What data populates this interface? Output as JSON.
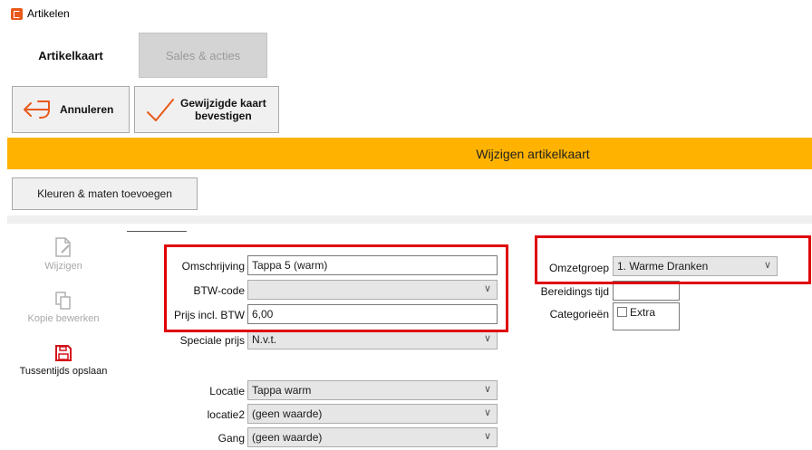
{
  "window": {
    "title": "Artikelen"
  },
  "tabs": [
    {
      "label": "Artikelkaart",
      "active": true
    },
    {
      "label": "Sales & acties",
      "active": false
    }
  ],
  "actions": {
    "cancel_label": "Annuleren",
    "confirm_label_line1": "Gewijzigde kaart",
    "confirm_label_line2": "bevestigen"
  },
  "banner": {
    "text": "Wijzigen artikelkaart",
    "color": "#ffb300"
  },
  "kleuren_button": {
    "label": "Kleuren & maten toevoegen"
  },
  "side_actions": [
    {
      "label": "Wijzigen",
      "icon": "document-edit-icon",
      "enabled": false
    },
    {
      "label": "Kopie bewerken",
      "icon": "copy-icon",
      "enabled": false
    },
    {
      "label": "Tussentijds opslaan",
      "icon": "save-icon",
      "enabled": true
    }
  ],
  "form": {
    "omschrijving": {
      "label": "Omschrijving",
      "value": "Tappa 5  (warm)"
    },
    "btw_code": {
      "label": "BTW-code",
      "value": ""
    },
    "prijs": {
      "label": "Prijs incl. BTW",
      "value": "6,00"
    },
    "speciale_prijs": {
      "label": "Speciale prijs",
      "value": "N.v.t."
    },
    "locatie": {
      "label": "Locatie",
      "value": "Tappa warm"
    },
    "locatie2": {
      "label": "locatie2",
      "value": "(geen waarde)"
    },
    "gang": {
      "label": "Gang",
      "value": "(geen waarde)"
    },
    "omzetgroep": {
      "label": "Omzetgroep",
      "value": "1. Warme Dranken"
    },
    "bereidingstijd": {
      "label": "Bereidings tijd",
      "value": ""
    },
    "categorieen": {
      "label": "Categorieën",
      "options": [
        {
          "label": "Extra",
          "checked": false
        }
      ]
    }
  },
  "colors": {
    "accent": "#ffb300",
    "highlight": "#e0000a",
    "save_icon": "#d4131b",
    "cancel_icon": "#e8591a"
  }
}
